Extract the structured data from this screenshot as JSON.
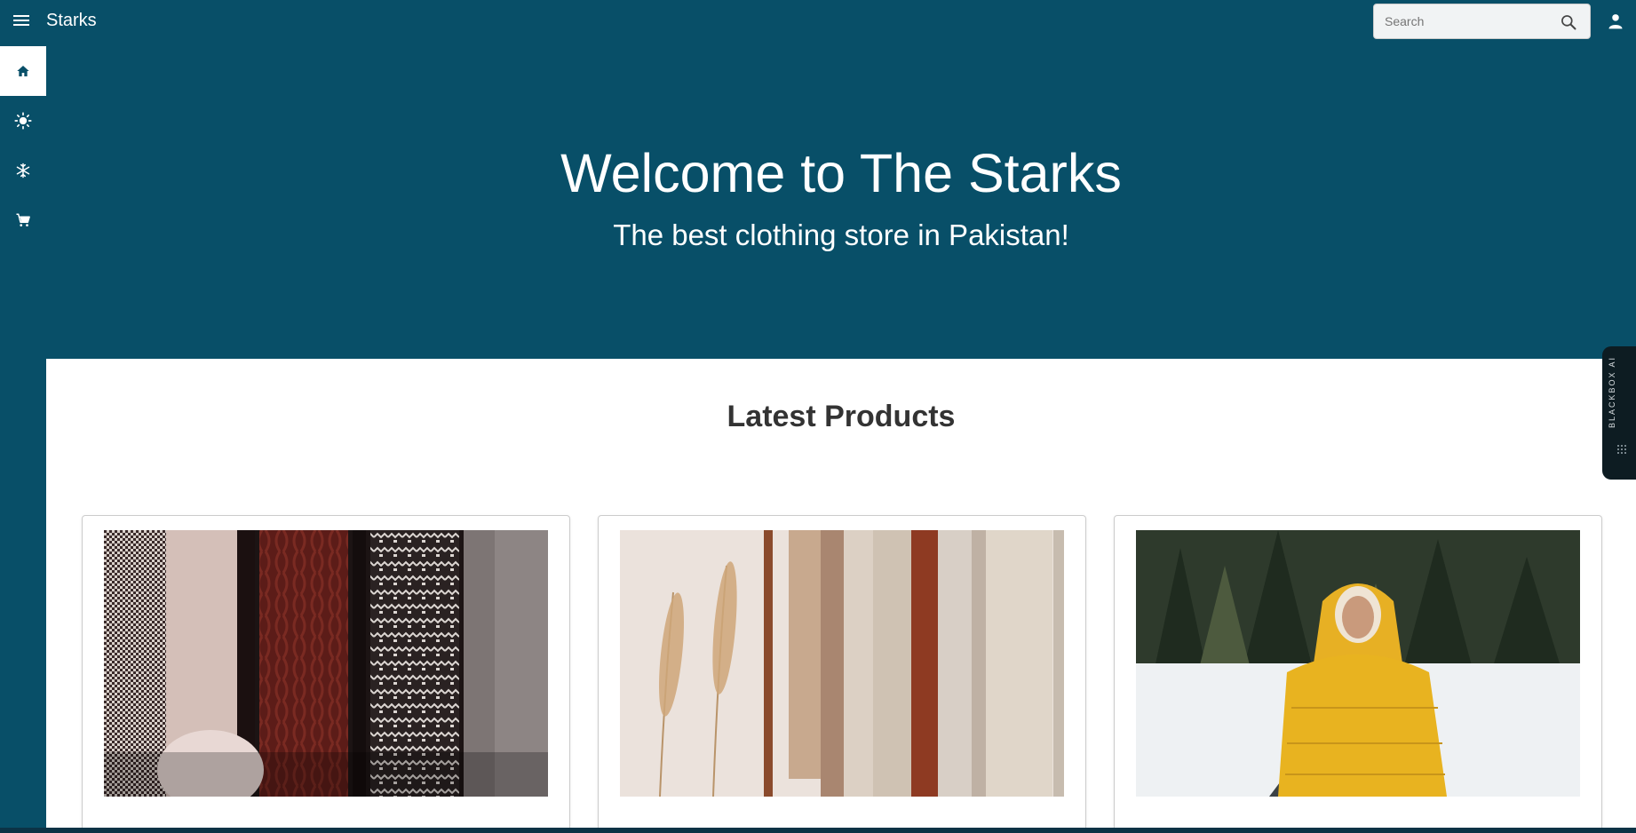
{
  "topbar": {
    "brand": "Starks",
    "search_placeholder": "Search"
  },
  "sidebar": {
    "items": [
      {
        "name": "home",
        "active": true
      },
      {
        "name": "summer",
        "active": false
      },
      {
        "name": "winter",
        "active": false
      },
      {
        "name": "cart",
        "active": false
      }
    ]
  },
  "hero": {
    "title": "Welcome to The Starks",
    "subtitle": "The best clothing store in Pakistan!"
  },
  "products": {
    "heading": "Latest Products"
  },
  "blackbox": {
    "label": "BLACKBOX AI"
  },
  "colors": {
    "primary": "#084f68",
    "surface": "#ffffff",
    "text_dark": "#333333"
  }
}
